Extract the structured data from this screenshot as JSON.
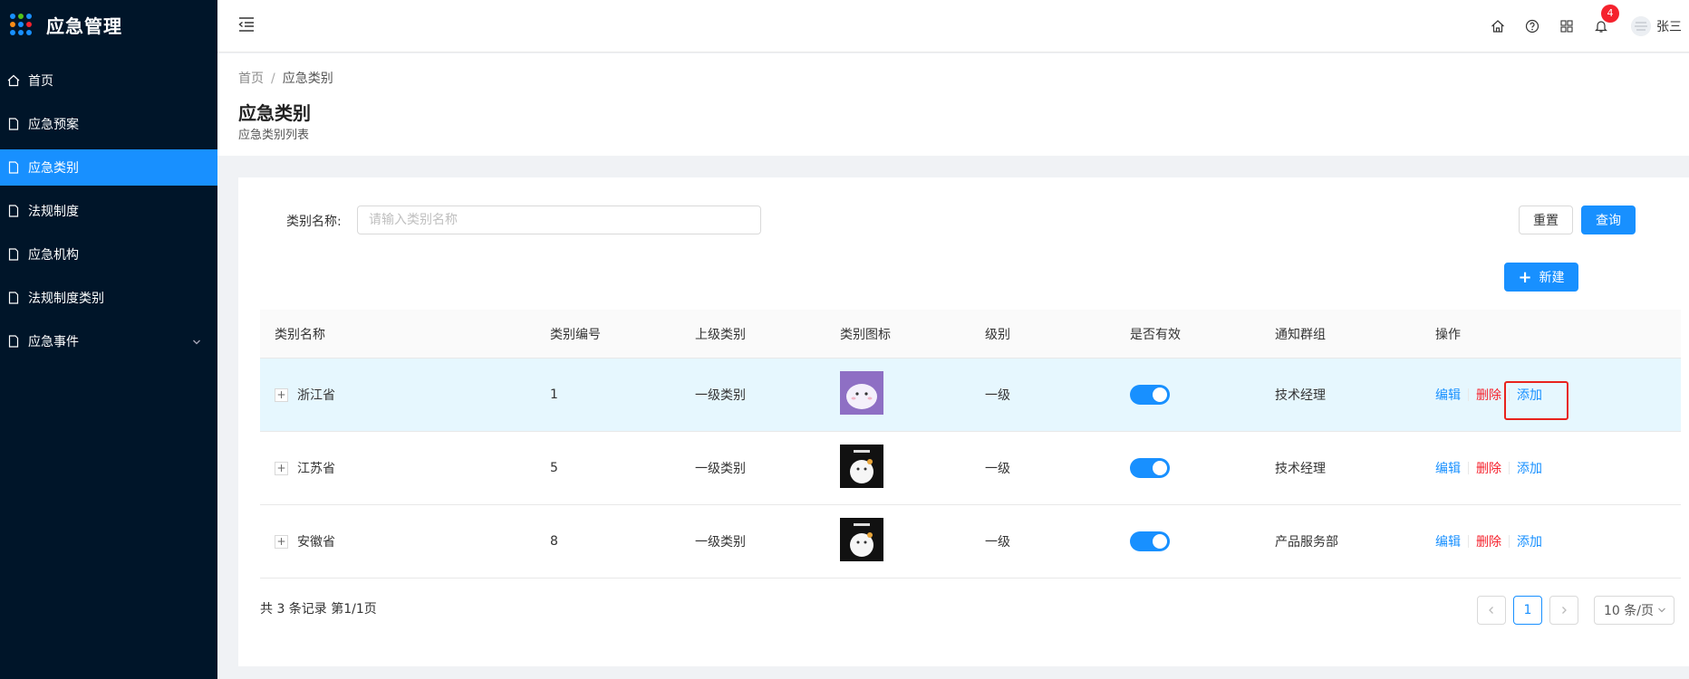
{
  "app": {
    "title": "应急管理"
  },
  "sidebar": {
    "items": [
      {
        "label": "首页",
        "icon": "home-icon"
      },
      {
        "label": "应急预案",
        "icon": "file-icon"
      },
      {
        "label": "应急类别",
        "icon": "file-icon",
        "active": true
      },
      {
        "label": "法规制度",
        "icon": "file-icon"
      },
      {
        "label": "应急机构",
        "icon": "file-icon"
      },
      {
        "label": "法规制度类别",
        "icon": "file-icon"
      },
      {
        "label": "应急事件",
        "icon": "file-icon",
        "has_children": true
      }
    ]
  },
  "header": {
    "notification_count": "4",
    "username": "张三",
    "icons": [
      "home-icon",
      "help-icon",
      "apps-icon",
      "bell-icon"
    ]
  },
  "page": {
    "breadcrumb": {
      "home": "首页",
      "separator": "/",
      "current": "应急类别"
    },
    "title": "应急类别",
    "subtitle": "应急类别列表"
  },
  "search": {
    "label": "类别名称:",
    "placeholder": "请输入类别名称",
    "reset_label": "重置",
    "query_label": "查询",
    "new_label": "新建"
  },
  "table": {
    "columns": [
      "类别名称",
      "类别编号",
      "上级类别",
      "类别图标",
      "级别",
      "是否有效",
      "通知群组",
      "操作"
    ],
    "rows": [
      {
        "name": "浙江省",
        "code": "1",
        "parent": "一级类别",
        "level": "一级",
        "valid": true,
        "group": "技术经理"
      },
      {
        "name": "江苏省",
        "code": "5",
        "parent": "一级类别",
        "level": "一级",
        "valid": true,
        "group": "技术经理"
      },
      {
        "name": "安徽省",
        "code": "8",
        "parent": "一级类别",
        "level": "一级",
        "valid": true,
        "group": "产品服务部"
      }
    ],
    "ops": {
      "edit": "编辑",
      "delete": "删除",
      "add": "添加"
    },
    "expand_symbol": "+"
  },
  "pagination": {
    "summary": "共 3 条记录 第1/1页",
    "current_page": "1",
    "page_size": "10 条/页"
  },
  "colors": {
    "primary": "#1890ff",
    "danger": "#f5222d",
    "sidebar": "#001529"
  }
}
